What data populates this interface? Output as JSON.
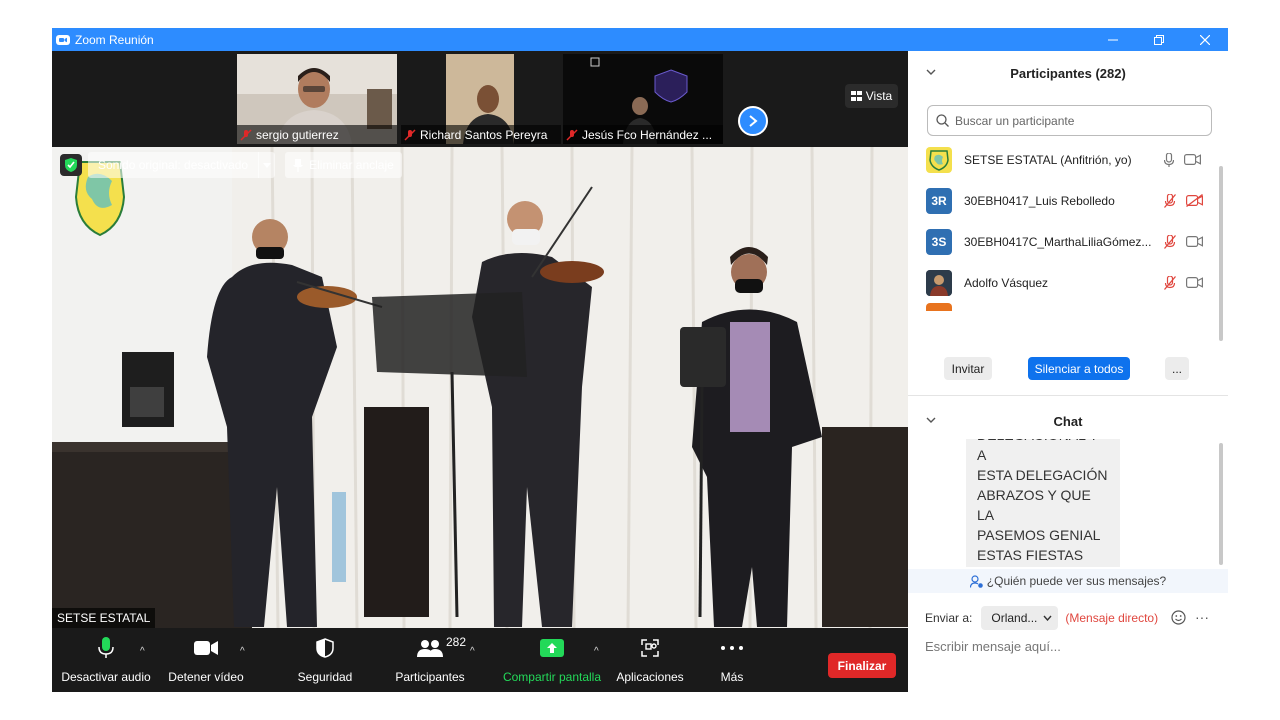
{
  "window": {
    "title": "Zoom Reunión"
  },
  "thumbnails": [
    {
      "name": "sergio gutierrez"
    },
    {
      "name": "Richard Santos Pereyra"
    },
    {
      "name": "Jesús Fco Hernández ..."
    }
  ],
  "view_button": {
    "label": "Vista"
  },
  "main_video": {
    "original_sound": "Sonido original: desactivado",
    "unpin": "Eliminar anclaje",
    "speaker_label": "SETSE ESTATAL"
  },
  "toolbar": {
    "mute": "Desactivar audio",
    "video": "Detener vídeo",
    "security": "Seguridad",
    "participants": "Participantes",
    "participants_count": "282",
    "share": "Compartir pantalla",
    "apps": "Aplicaciones",
    "more": "Más",
    "end": "Finalizar"
  },
  "participants_panel": {
    "title": "Participantes (282)",
    "search_placeholder": "Buscar un participante",
    "participants": [
      {
        "name": "SETSE ESTATAL (Anfitrión, yo)",
        "initials": "",
        "avatar_color": "#f4e04d",
        "mic": "on",
        "video": "on"
      },
      {
        "name": "30EBH0417_Luis Rebolledo",
        "initials": "3R",
        "avatar_color": "#2f6fb2",
        "mic": "muted",
        "video": "off"
      },
      {
        "name": "30EBH0417C_MarthaLiliaGómez...",
        "initials": "3S",
        "avatar_color": "#2f6fb2",
        "mic": "muted",
        "video": "on"
      },
      {
        "name": "Adolfo Vásquez",
        "initials": "",
        "avatar_color": "#3a4a5a",
        "mic": "muted",
        "video": "on"
      }
    ],
    "invite": "Invitar",
    "mute_all": "Silenciar a todos",
    "more": "..."
  },
  "chat_panel": {
    "title": "Chat",
    "message": "DELEGACIONAL Y A\nESTA DELEGACIÓN\nABRAZOS Y QUE LA\nPASEMOS GENIAL\nESTAS FIESTAS\nDECEMBRINAS",
    "who_can_see": "¿Quién puede ver sus mensajes?",
    "send_to_label": "Enviar a:",
    "recipient": "Orland...",
    "direct_message": "(Mensaje directo)",
    "more": "···",
    "input_placeholder": "Escribir mensaje aquí..."
  },
  "colors": {
    "zoom_blue": "#2d8cff",
    "end_red": "#e02828",
    "share_green": "#23d959"
  }
}
